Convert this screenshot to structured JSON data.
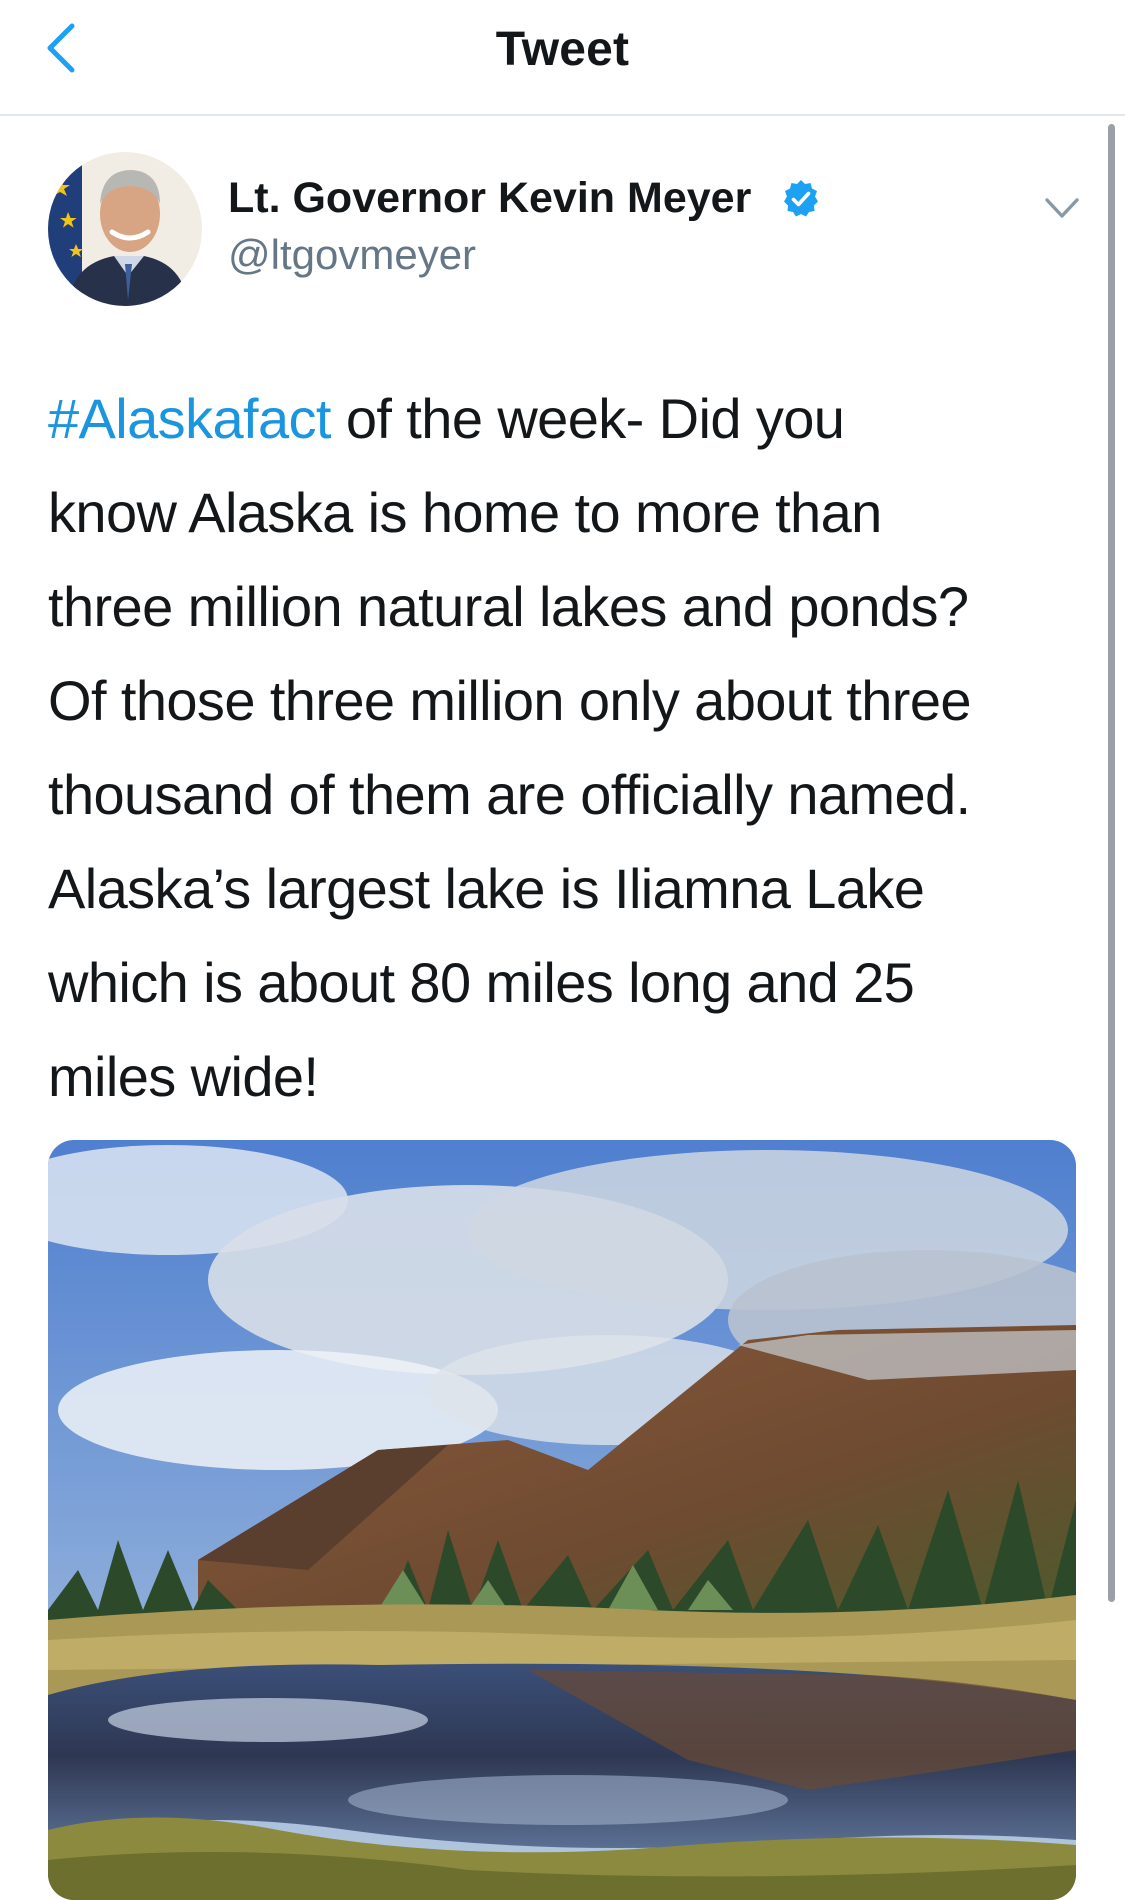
{
  "header": {
    "title": "Tweet",
    "back_icon": "chevron-left-icon"
  },
  "author": {
    "name": "Lt. Governor Kevin Meyer",
    "handle": "@ltgovmeyer",
    "verified_icon": "verified-badge-icon",
    "menu_icon": "chevron-down-icon"
  },
  "tweet": {
    "hashtag": "#Alaskafact",
    "line1_rest": " of the week- Did you",
    "line2": "know Alaska is home to more than",
    "line3": "three million natural lakes and ponds?",
    "line4": "Of those three million only about three",
    "line5": "thousand of them are officially named.",
    "line6": "Alaska’s largest lake is Iliamna Lake",
    "line7": "which is about 80 miles long and 25",
    "line8": "miles wide!"
  },
  "colors": {
    "accent": "#1da1f2",
    "hashtag": "#1b95e0",
    "text": "#14171a",
    "secondary_text": "#657786",
    "divider": "#e1e8ed"
  },
  "media": {
    "icon": "landscape-photo"
  }
}
